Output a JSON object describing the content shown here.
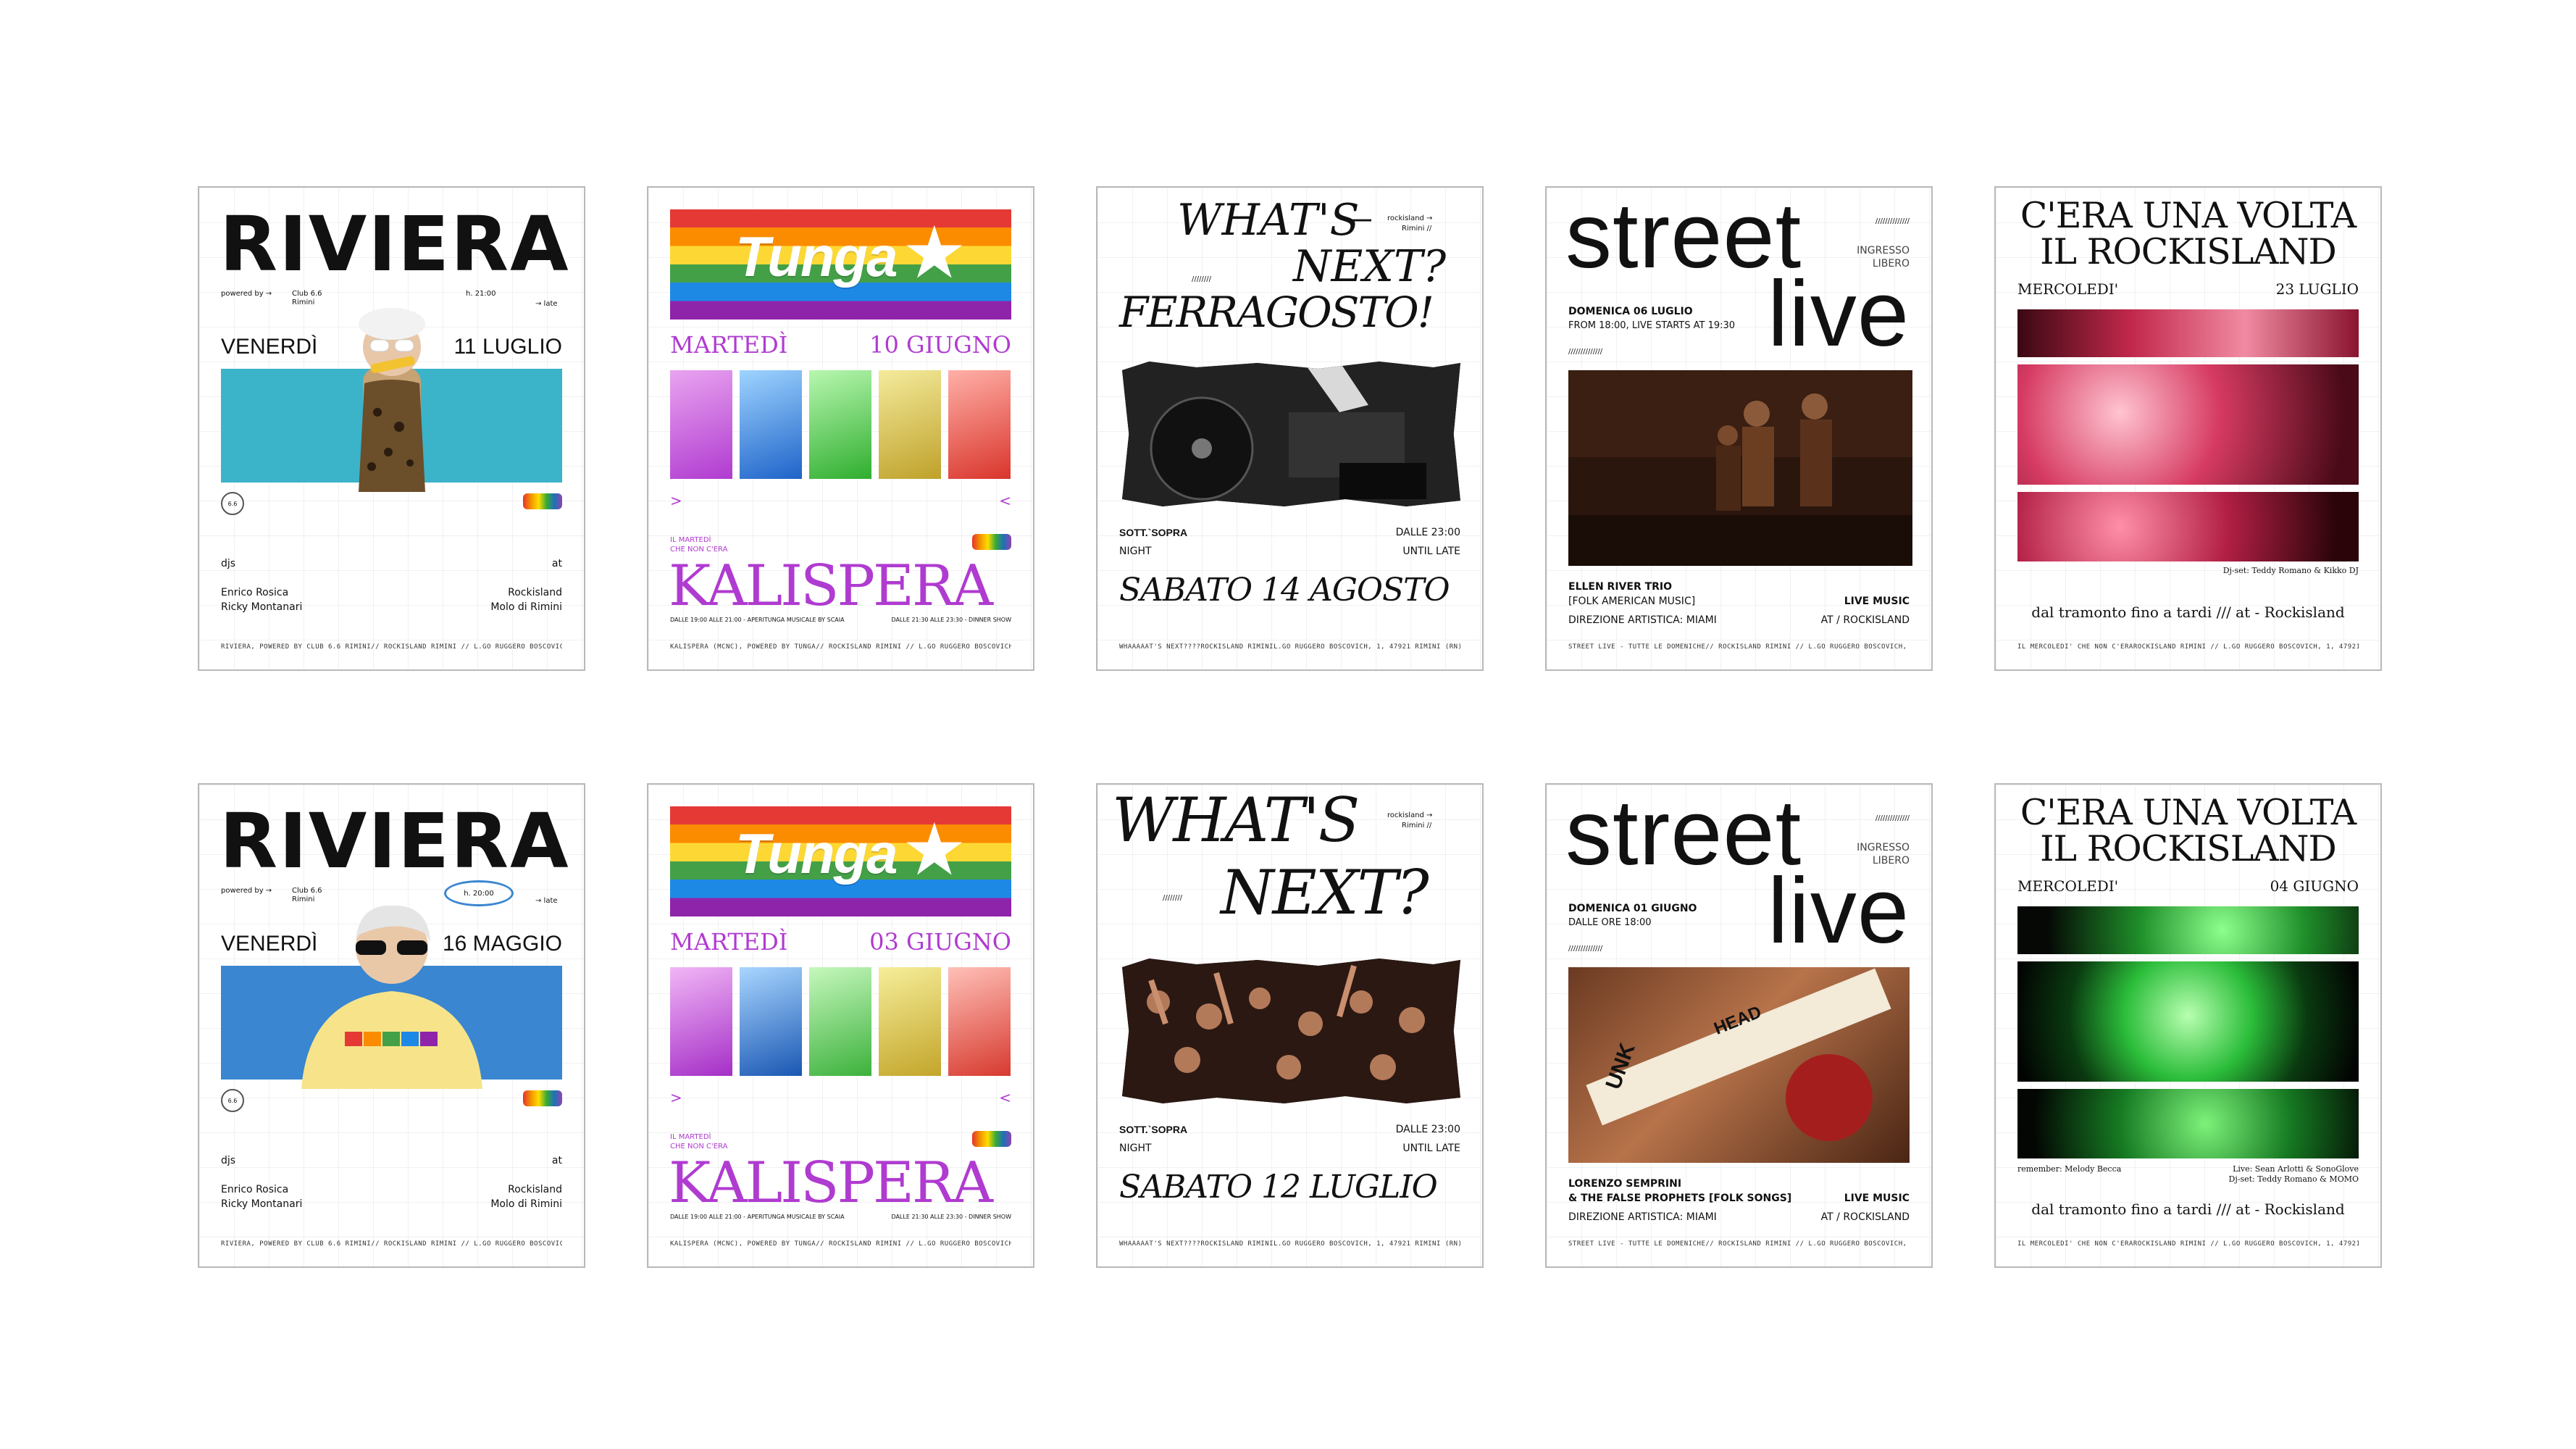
{
  "riviera_1": {
    "title": "RIVIERA",
    "powered_by": "powered by →",
    "club": "Club 6.6",
    "club_city": "Rimini",
    "time": "h. 21:00",
    "late": "→ late",
    "day": "VENERDÌ",
    "date": "11 LUGLIO",
    "djs_label": "djs",
    "at_label": "at",
    "dj1": "Enrico Rosica",
    "dj2": "Ricky Montanari",
    "venue1": "Rockisland",
    "venue2": "Molo di Rimini",
    "footer_left": "RIVIERA, POWERED BY CLUB 6.6 RIMINI",
    "footer_right": "// ROCKISLAND RIMINI // L.GO RUGGERO BOSCOVICH, 1, 47921 RIMINI (RN)",
    "band_color": "#3bb3c9",
    "badge": "6.6"
  },
  "riviera_2": {
    "title": "RIVIERA",
    "powered_by": "powered by →",
    "club": "Club 6.6",
    "club_city": "Rimini",
    "time": "h. 20:00",
    "late": "→ late",
    "day": "VENERDÌ",
    "date": "16 MAGGIO",
    "djs_label": "djs",
    "at_label": "at",
    "dj1": "Enrico Rosica",
    "dj2": "Ricky Montanari",
    "venue1": "Rockisland",
    "venue2": "Molo di Rimini",
    "footer_left": "RIVIERA, POWERED BY CLUB 6.6 RIMINI",
    "footer_right": "// ROCKISLAND RIMINI // L.GO RUGGERO BOSCOVICH, 1, 47921 RIMINI (RN)",
    "band_color": "#3a86d1",
    "badge": "6.6"
  },
  "tunga_1": {
    "logo": "Tunga",
    "day": "MARTEDÌ",
    "date": "10 GIUGNO",
    "subtitle1": "IL MARTEDÌ",
    "subtitle2": "CHE NON C'ERA",
    "name": "KALISPERA",
    "sched_left": "DALLE 19:00 ALLE 21:00 - APERITUNGA MUSICALE BY SCAIA",
    "sched_right": "DALLE 21:30 ALLE 23:30 - DINNER SHOW",
    "footer_left": "KALISPERA (MCNC), POWERED BY TUNGA",
    "footer_right": "// ROCKISLAND RIMINI // L.GO RUGGERO BOSCOVICH, 1, 47921 RIMINI (RN)"
  },
  "tunga_2": {
    "logo": "Tunga",
    "day": "MARTEDÌ",
    "date": "03 GIUGNO",
    "subtitle1": "IL MARTEDÌ",
    "subtitle2": "CHE NON C'ERA",
    "name": "KALISPERA",
    "sched_left": "DALLE 19:00 ALLE 21:00 - APERITUNGA MUSICALE BY SCAIA",
    "sched_right": "DALLE 21:30 ALLE 23:30 - DINNER SHOW",
    "footer_left": "KALISPERA (MCNC), POWERED BY TUNGA",
    "footer_right": "// ROCKISLAND RIMINI // L.GO RUGGERO BOSCOVICH, 1, 47921 RIMINI (RN)"
  },
  "next_1": {
    "l1": "WHAT'S",
    "dash": "—",
    "l2": "NEXT?",
    "l3": "FERRAGOSTO!",
    "loc1": "rockisland →",
    "loc2": "Rimini //",
    "slashes": "////////",
    "sotto": "SOTT.`SOPRA",
    "night": "NIGHT",
    "dalle": "DALLE 23:00",
    "until": "UNTIL LATE",
    "date": "SABATO 14 AGOSTO",
    "f1": "WHAAAAAT'S NEXT????",
    "f2": "ROCKISLAND RIMINI",
    "f3": "L.GO RUGGERO BOSCOVICH, 1, 47921 RIMINI (RN)"
  },
  "next_2": {
    "l1": "WHAT'S",
    "l2": "NEXT?",
    "loc1": "rockisland →",
    "loc2": "Rimini //",
    "slashes": "////////",
    "sotto": "SOTT.`SOPRA",
    "night": "NIGHT",
    "dalle": "DALLE 23:00",
    "until": "UNTIL LATE",
    "date": "SABATO 12 LUGLIO",
    "f1": "WHAAAAAT'S NEXT????",
    "f2": "ROCKISLAND RIMINI",
    "f3": "L.GO RUGGERO BOSCOVICH, 1, 47921 RIMINI (RN)"
  },
  "street_1": {
    "w1": "street",
    "w2": "live",
    "slashes": "//////////////",
    "ingresso": "INGRESSO",
    "libero": "LIBERO",
    "date": "DOMENICA 06 LUGLIO",
    "time": "FROM 18:00, LIVE STARTS AT 19:30",
    "slashes2": "//////////////",
    "artist1": "ELLEN RIVER TRIO",
    "artist2": "[FOLK AMERICAN MUSIC]",
    "direction": "DIREZIONE ARTISTICA: MIAMI",
    "live_music": "LIVE MUSIC",
    "at": "AT / ROCKISLAND",
    "footer_left": "STREET LIVE - TUTTE LE DOMENICHE",
    "footer_right": "// ROCKISLAND RIMINI // L.GO RUGGERO BOSCOVICH, 1, 47921 RIMINI (RN)"
  },
  "street_2": {
    "w1": "street",
    "w2": "live",
    "slashes": "//////////////",
    "ingresso": "INGRESSO",
    "libero": "LIBERO",
    "date": "DOMENICA 01 GIUGNO",
    "time": "DALLE ORE 18:00",
    "slashes2": "//////////////",
    "artist1": "LORENZO SEMPRINI",
    "artist2": "& THE FALSE PROPHETS [FOLK SONGS]",
    "direction": "DIREZIONE ARTISTICA: MIAMI",
    "live_music": "LIVE MUSIC",
    "at": "AT / ROCKISLAND",
    "footer_left": "STREET LIVE - TUTTE LE DOMENICHE",
    "footer_right": "// ROCKISLAND RIMINI // L.GO RUGGERO BOSCOVICH, 1, 47921 RIMINI (RN)",
    "guitar_text1": "UNK",
    "guitar_text2": "HEAD"
  },
  "rock_1": {
    "t1": "C'ERA UNA VOLTA",
    "t2": "IL ROCKISLAND",
    "day": "MERCOLEDI'",
    "date": "23 LUGLIO",
    "credits": "Dj-set: Teddy Romano & Kikko DJ",
    "tag": "dal tramonto fino a tardi /// at - Rockisland",
    "footer_left": "IL MERCOLEDI' CHE NON C'ERA",
    "footer_right": "ROCKISLAND RIMINI // L.GO RUGGERO BOSCOVICH, 1, 47921 RIMINI (RN)"
  },
  "rock_2": {
    "t1": "C'ERA UNA VOLTA",
    "t2": "IL ROCKISLAND",
    "day": "MERCOLEDI'",
    "date": "04 GIUGNO",
    "remember": "remember: Melody Becca",
    "live": "Live: Sean Arlotti & SonoGlove",
    "djset": "Dj-set: Teddy Romano & MOMO",
    "tag": "dal tramonto fino a tardi /// at - Rockisland",
    "footer_left": "IL MERCOLEDI' CHE NON C'ERA",
    "footer_right": "ROCKISLAND RIMINI // L.GO RUGGERO BOSCOVICH, 1, 47921 RIMINI (RN)"
  }
}
